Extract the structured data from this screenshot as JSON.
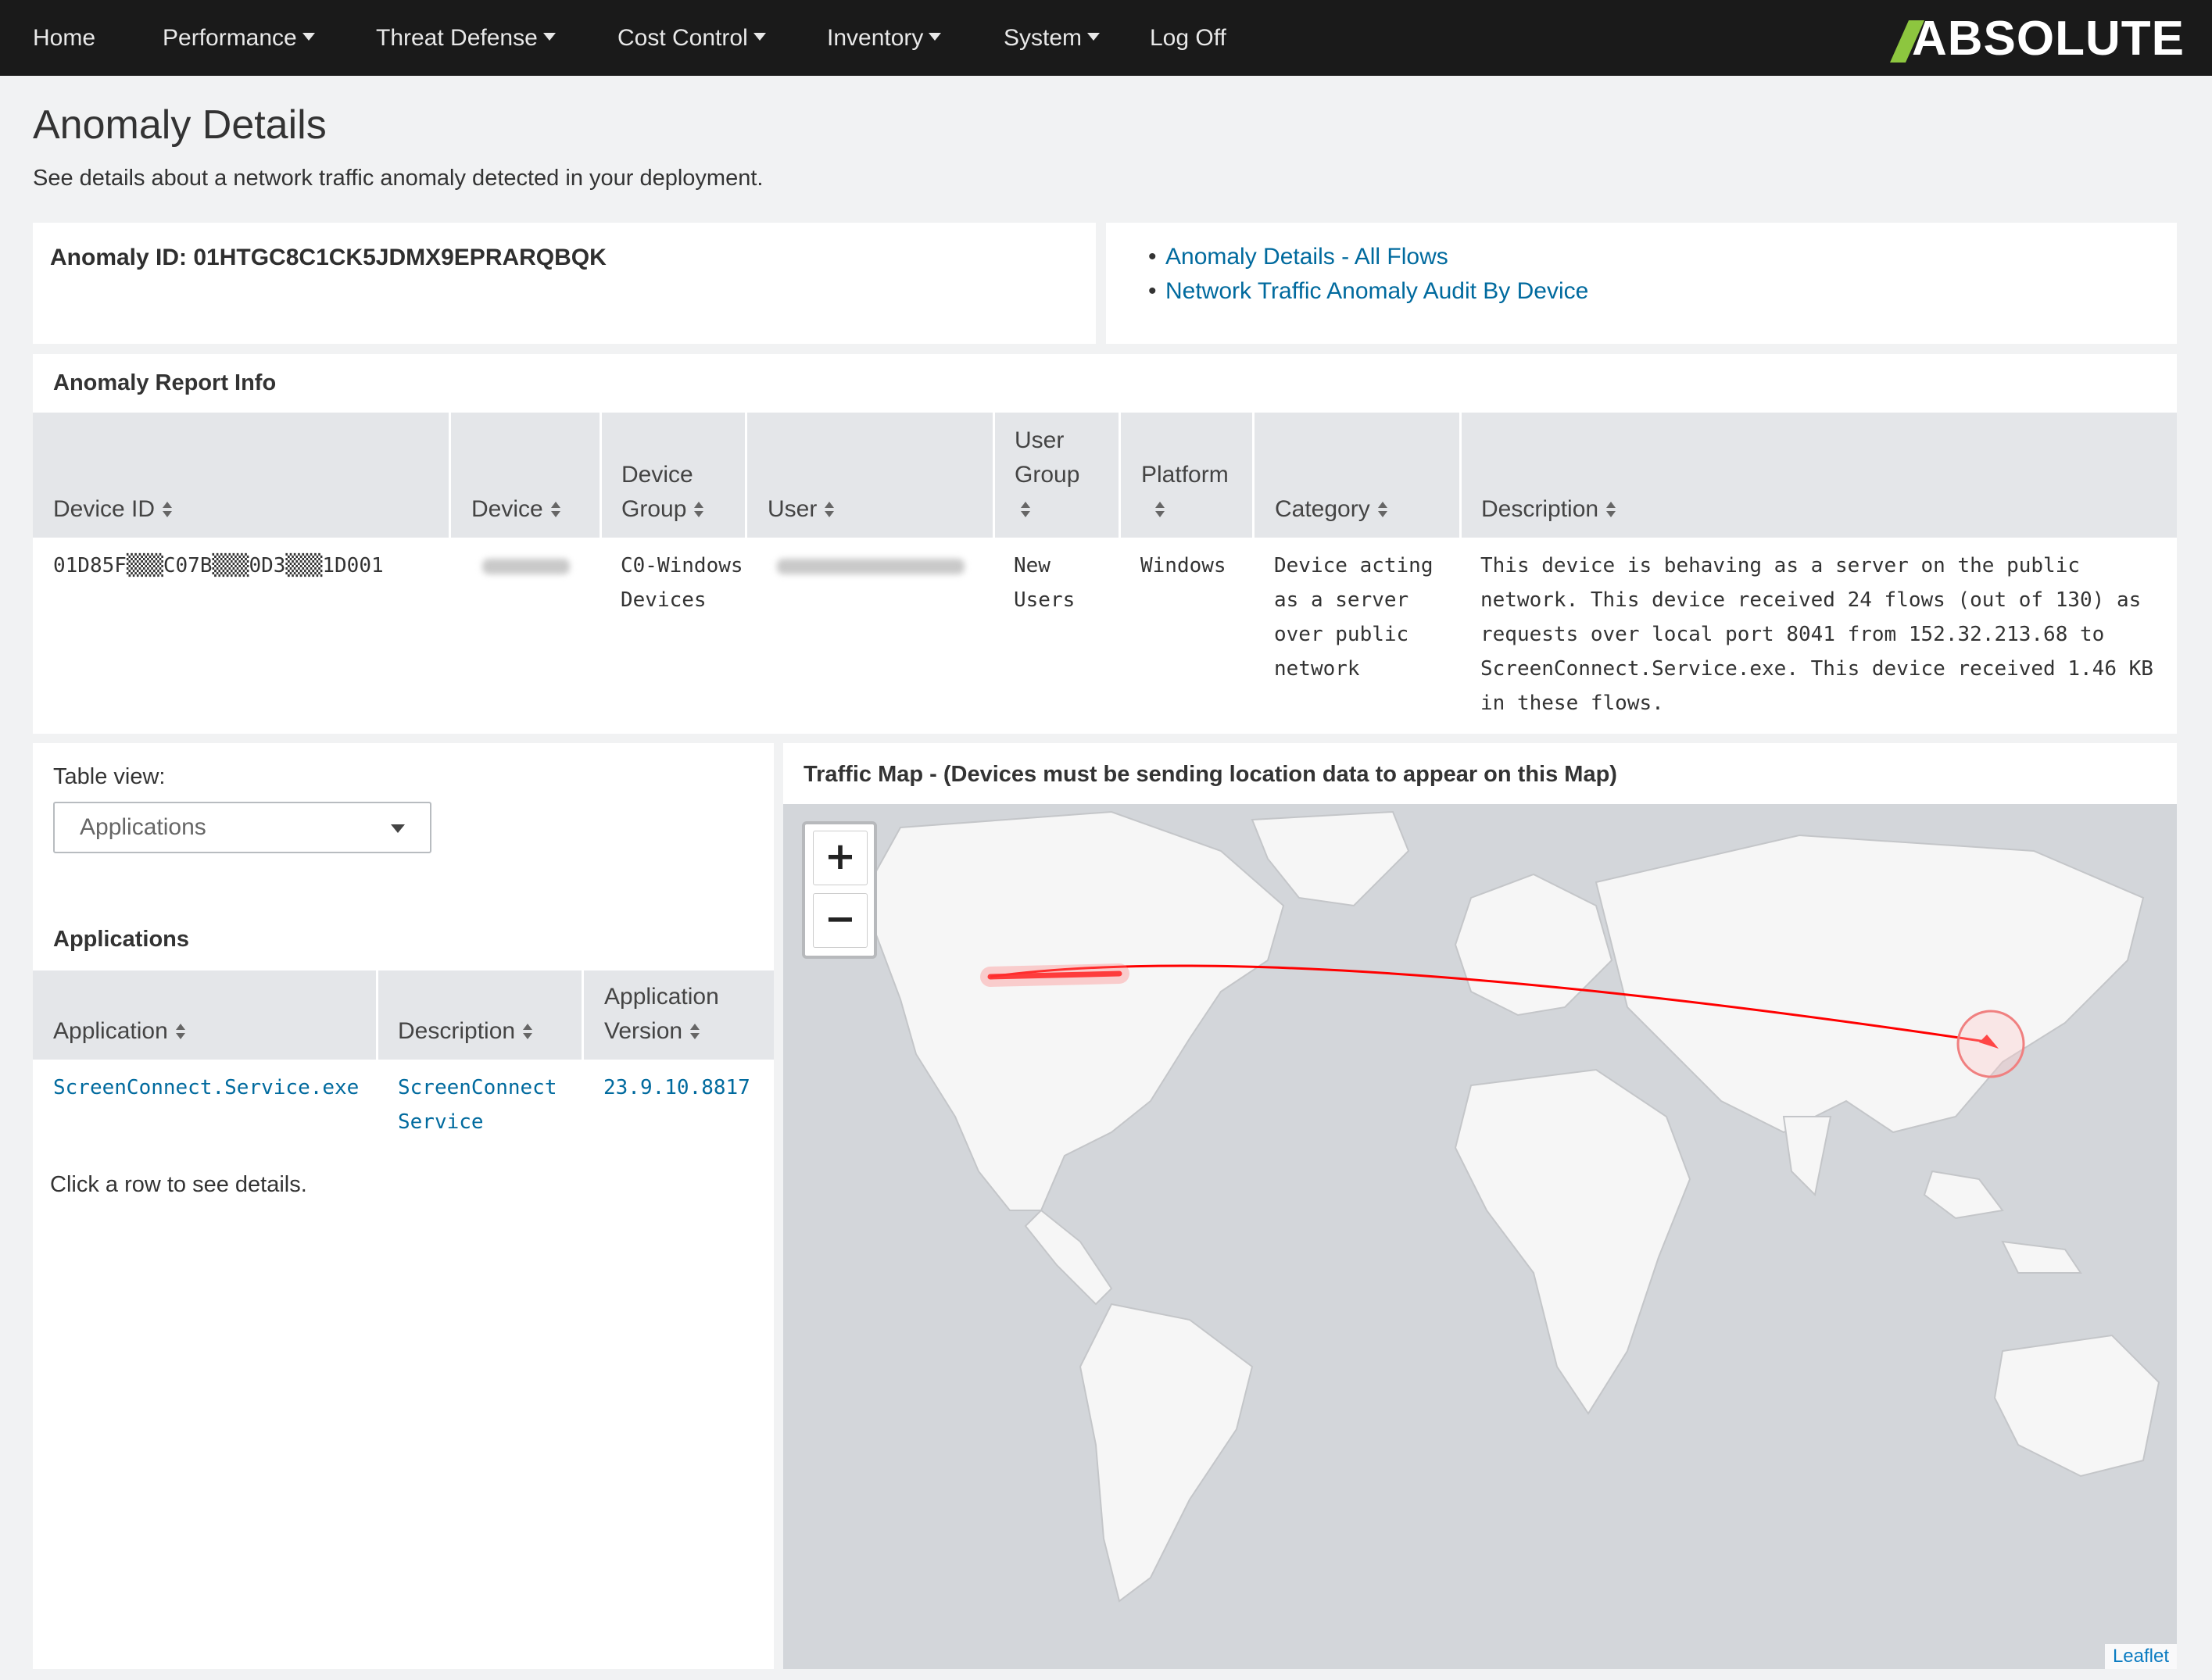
{
  "nav": {
    "items": [
      {
        "label": "Home",
        "has_caret": false
      },
      {
        "label": "Performance",
        "has_caret": true
      },
      {
        "label": "Threat Defense",
        "has_caret": true
      },
      {
        "label": "Cost Control",
        "has_caret": true
      },
      {
        "label": "Inventory",
        "has_caret": true
      },
      {
        "label": "System",
        "has_caret": true
      },
      {
        "label": "Log Off",
        "has_caret": false
      }
    ],
    "logo": "ABSOLUTE"
  },
  "header": {
    "title": "Anomaly Details",
    "subtitle": "See details about a network traffic anomaly detected in your deployment."
  },
  "anomaly": {
    "id_label": "Anomaly ID: 01HTGC8C1CK5JDMX9EPRARQBQK"
  },
  "links": [
    "Anomaly Details - All Flows",
    "Network Traffic Anomaly Audit By Device"
  ],
  "report": {
    "title": "Anomaly Report Info",
    "columns": [
      "Device ID",
      "Device",
      "Device Group",
      "User",
      "User Group",
      "Platform",
      "Category",
      "Description"
    ],
    "row": {
      "device_id": "01D85F▒▒▒C07B▒▒▒0D3▒▒▒1D001",
      "device_group": "C0-Windows Devices",
      "user_group": "New Users",
      "platform": "Windows",
      "category": "Device acting as a server over public network",
      "description": "This device is behaving as a server on the public network. This device received 24 flows (out of 130) as requests over local port 8041 from 152.32.213.68 to ScreenConnect.Service.exe. This device received 1.46 KB in these flows."
    }
  },
  "table_view": {
    "label": "Table view:",
    "selected": "Applications"
  },
  "applications": {
    "title": "Applications",
    "columns": [
      "Application",
      "Description",
      "Application Version"
    ],
    "row": {
      "application": "ScreenConnect.Service.exe",
      "description": "ScreenConnect Service",
      "version": "23.9.10.8817"
    },
    "hint": "Click a row to see details."
  },
  "map": {
    "title": "Traffic Map - (Devices must be sending location data to appear on this Map)",
    "zoom_in": "+",
    "zoom_out": "−",
    "attribution": "Leaflet",
    "flow_color": "#ff0000"
  },
  "colors": {
    "nav_bg": "#1a1a1a",
    "accent_green": "#8dc63f",
    "link": "#006a9e",
    "table_header": "#e4e6e9"
  }
}
